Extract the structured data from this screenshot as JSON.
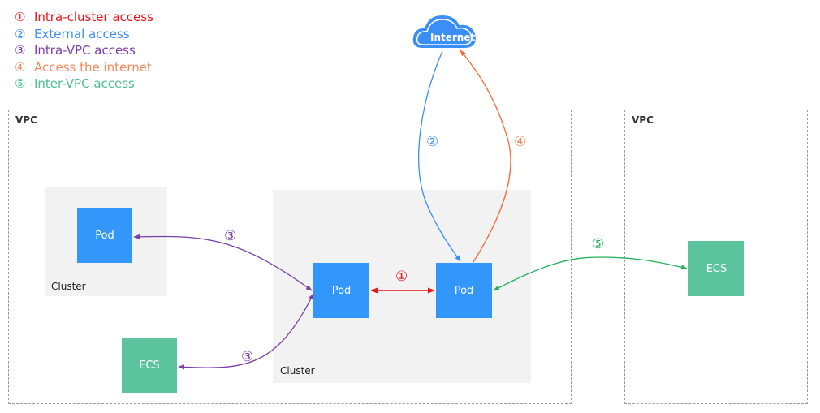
{
  "legend": [
    {
      "num": "①",
      "label": "Intra-cluster access",
      "color": "#e8151a"
    },
    {
      "num": "②",
      "label": "External access",
      "color": "#3a8ef5"
    },
    {
      "num": "③",
      "label": "Intra-VPC access",
      "color": "#7a3fa8"
    },
    {
      "num": "④",
      "label": "Access the internet",
      "color": "#f08a5d"
    },
    {
      "num": "⑤",
      "label": "Inter-VPC access",
      "color": "#4cbf8f"
    }
  ],
  "internet": {
    "label": "Internet"
  },
  "vpcs": [
    {
      "label": "VPC"
    },
    {
      "label": "VPC"
    }
  ],
  "clusters": [
    {
      "label": "Cluster"
    },
    {
      "label": "Cluster"
    }
  ],
  "nodes": {
    "pod_left": "Pod",
    "pod_center_left": "Pod",
    "pod_center_right": "Pod",
    "ecs_bottom": "ECS",
    "ecs_right": "ECS"
  },
  "markers": {
    "m1": "①",
    "m2": "②",
    "m3a": "③",
    "m3b": "③",
    "m4": "④",
    "m5": "⑤"
  },
  "colors": {
    "pod": "#3296fa",
    "ecs": "#5bc49f",
    "intra_cluster": "#e8151a",
    "external": "#3a8ef5",
    "intra_vpc": "#7a3fa8",
    "internet": "#f26b38",
    "inter_vpc": "#1fb25a"
  }
}
